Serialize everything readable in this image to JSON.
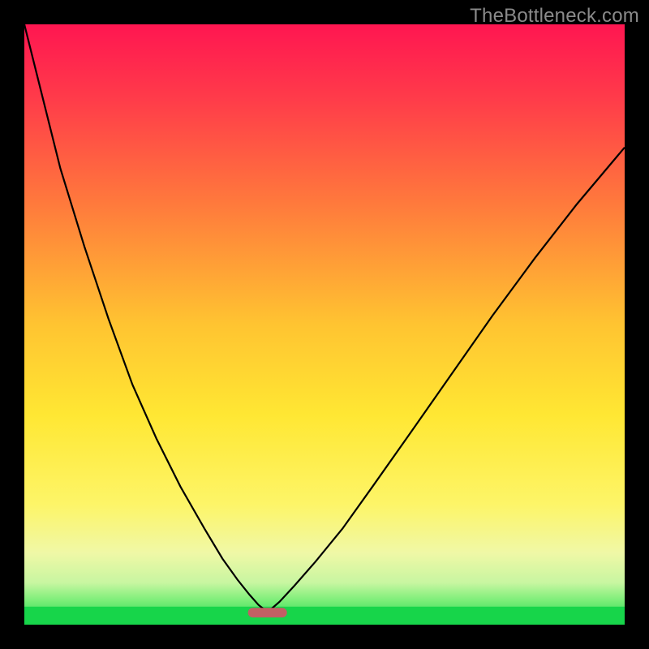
{
  "watermark": "TheBottleneck.com",
  "chart_data": {
    "type": "line",
    "title": "",
    "xlabel": "",
    "ylabel": "",
    "xlim": [
      0,
      100
    ],
    "ylim": [
      0,
      100
    ],
    "grid": false,
    "legend": false,
    "gradient_stops": [
      {
        "pct": 0,
        "color": "#ff1651"
      },
      {
        "pct": 12,
        "color": "#ff3a4a"
      },
      {
        "pct": 30,
        "color": "#ff7a3c"
      },
      {
        "pct": 50,
        "color": "#ffc431"
      },
      {
        "pct": 65,
        "color": "#ffe733"
      },
      {
        "pct": 80,
        "color": "#fdf568"
      },
      {
        "pct": 88,
        "color": "#f0f8a6"
      },
      {
        "pct": 93,
        "color": "#c8f6a1"
      },
      {
        "pct": 96,
        "color": "#7bee78"
      },
      {
        "pct": 100,
        "color": "#17d54a"
      }
    ],
    "bottom_band": {
      "y_from": 97.0,
      "y_to": 100.0,
      "color": "#17d54a"
    },
    "marker": {
      "x": 40.5,
      "y": 98.0,
      "w": 6.5,
      "h": 1.6,
      "rx": 0.8,
      "color": "#c26064"
    },
    "series": [
      {
        "name": "left-branch",
        "x": [
          0,
          3,
          6,
          10,
          14,
          18,
          22,
          26,
          30,
          33,
          35.5,
          37.5,
          39.0,
          40.0
        ],
        "y": [
          0,
          12,
          24,
          37,
          49,
          60,
          69,
          77,
          84,
          89,
          92.5,
          95.0,
          96.7,
          97.5
        ]
      },
      {
        "name": "right-branch",
        "x": [
          41.0,
          42.5,
          45.0,
          48.5,
          53.0,
          58.0,
          64.0,
          71.0,
          78.0,
          85.0,
          92.0,
          100.0
        ],
        "y": [
          97.5,
          96.2,
          93.5,
          89.5,
          84.0,
          77.0,
          68.5,
          58.5,
          48.5,
          39.0,
          30.0,
          20.5
        ]
      }
    ]
  }
}
